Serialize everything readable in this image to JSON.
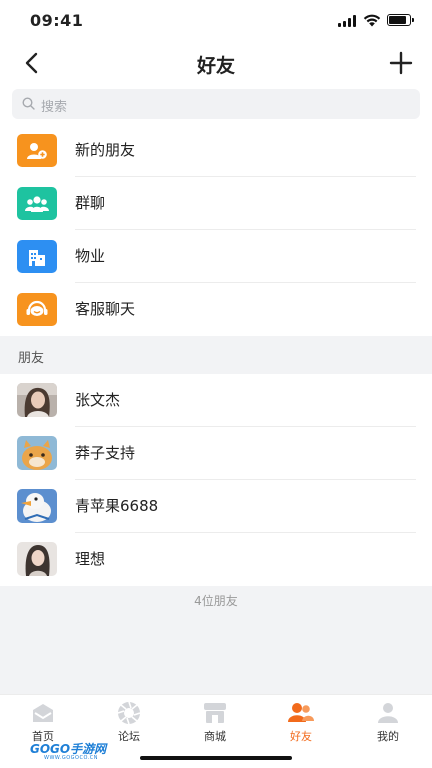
{
  "status": {
    "time": "09:41"
  },
  "header": {
    "title": "好友"
  },
  "search": {
    "placeholder": "搜索"
  },
  "menu": [
    {
      "label": "新的朋友",
      "icon": "add-friend-icon",
      "color": "#f7931e"
    },
    {
      "label": "群聊",
      "icon": "group-chat-icon",
      "color": "#1ec3a0"
    },
    {
      "label": "物业",
      "icon": "building-icon",
      "color": "#2d8ff2"
    },
    {
      "label": "客服聊天",
      "icon": "customer-service-icon",
      "color": "#f7931e"
    }
  ],
  "friends_header": "朋友",
  "friends": [
    {
      "name": "张文杰"
    },
    {
      "name": "莽子支持"
    },
    {
      "name": "青苹果6688"
    },
    {
      "name": "理想"
    }
  ],
  "friend_count": "4位朋友",
  "tabs": [
    {
      "label": "首页",
      "icon": "home-icon"
    },
    {
      "label": "论坛",
      "icon": "forum-icon"
    },
    {
      "label": "商城",
      "icon": "shop-icon"
    },
    {
      "label": "好友",
      "icon": "friends-icon",
      "active": true
    },
    {
      "label": "我的",
      "icon": "profile-icon"
    }
  ],
  "colors": {
    "accent": "#f26a1b",
    "background": "#f2f3f5"
  },
  "watermark": {
    "text": "GOGO手游网",
    "sub": "WWW.GOGOCO.CN"
  }
}
